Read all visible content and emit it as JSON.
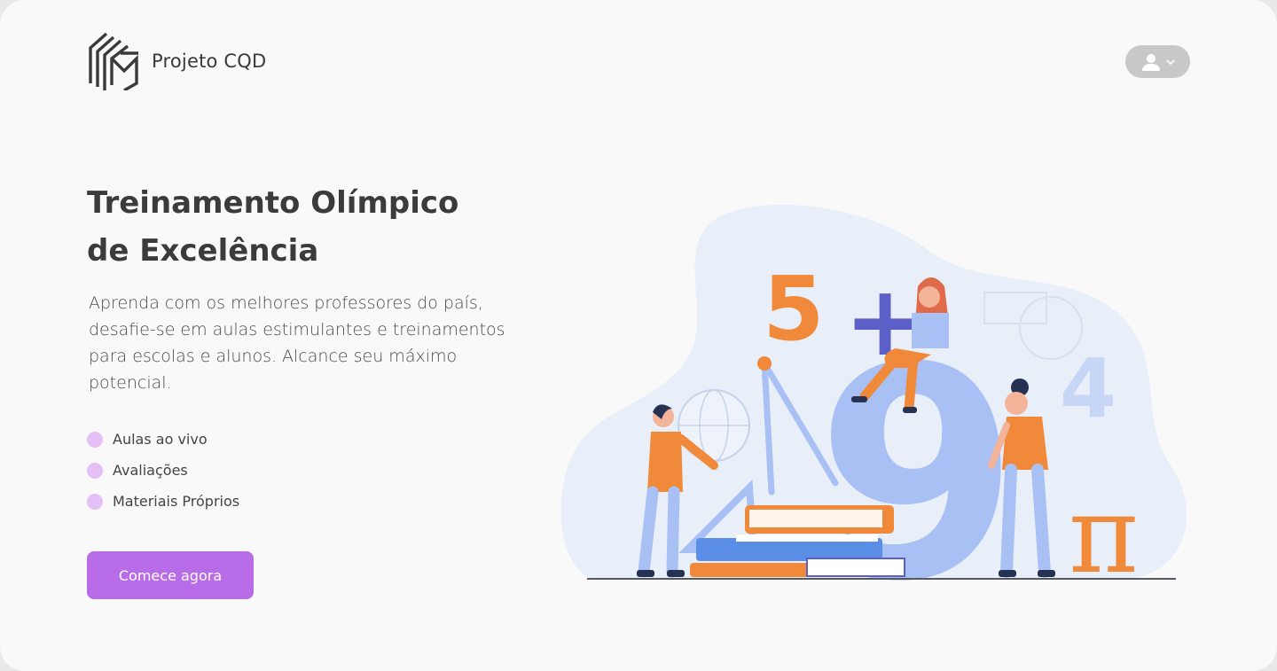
{
  "header": {
    "brand_name": "Projeto CQD",
    "logo_icon": "cqd-logo-icon",
    "user_menu": {
      "icon": "user-icon",
      "chevron": "chevron-down-icon"
    }
  },
  "hero": {
    "title_line1": "Treinamento Olímpico",
    "title_line2": "de Excelência",
    "description": "Aprenda com os melhores professores do país, desafie-se em aulas estimulantes e treinamentos para escolas e alunos. Alcance seu máximo potencial.",
    "features": [
      {
        "label": "Aulas ao vivo"
      },
      {
        "label": "Avaliações"
      },
      {
        "label": "Materiais Próprios"
      }
    ],
    "cta_label": "Comece agora"
  },
  "illustration": {
    "glyphs": {
      "five": "5",
      "four": "4",
      "nine": "9",
      "plus": "+",
      "pi": "π"
    }
  },
  "colors": {
    "accent": "#b96ce8",
    "bullet": "#e4c0f6",
    "text_dark": "#3b3b3b",
    "illustration_blue": "#a9c0f5",
    "illustration_orange": "#f0893a",
    "illustration_purple": "#5b5fc7"
  }
}
